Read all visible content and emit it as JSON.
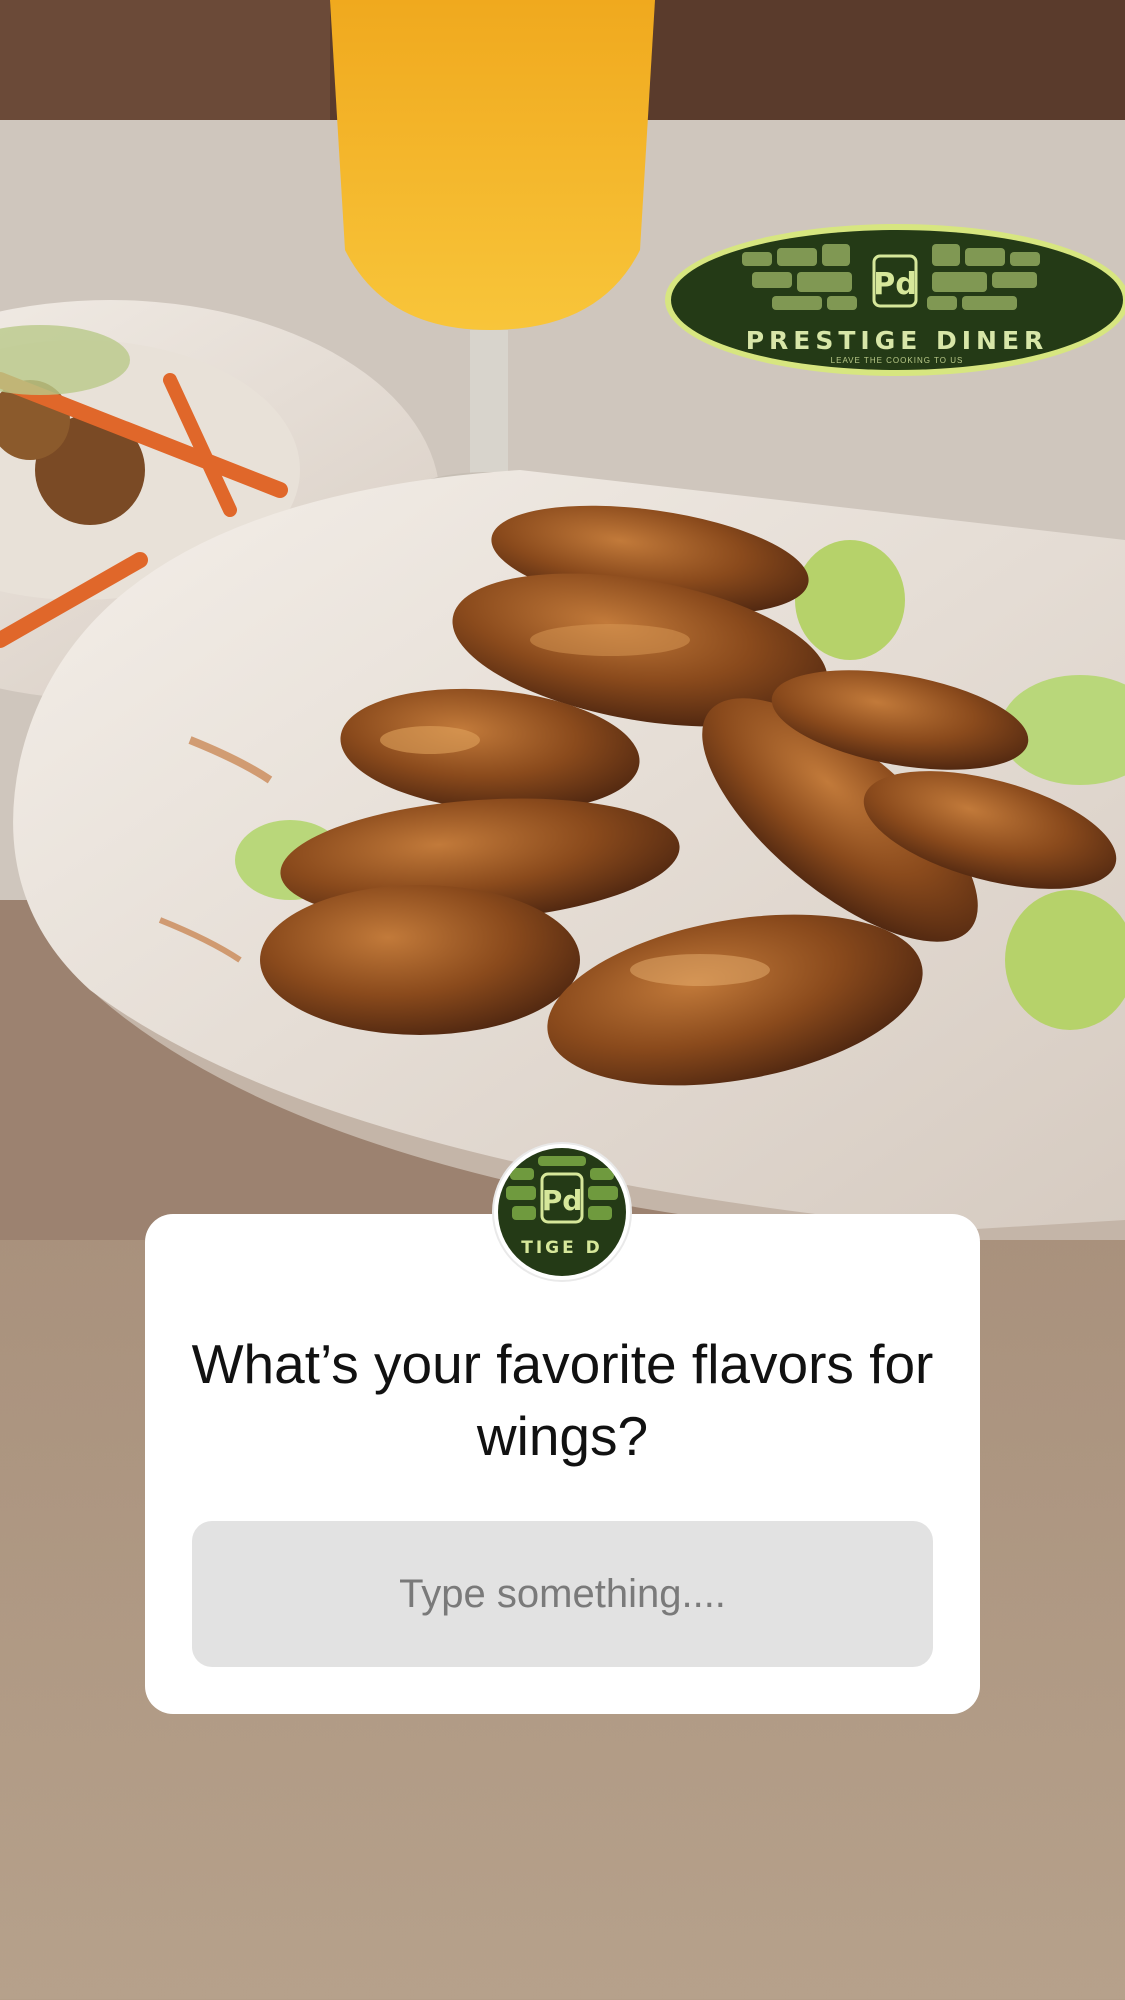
{
  "background_photo": {
    "description_icon": "chicken-wings-photo"
  },
  "brand": {
    "name": "PRESTIGE DINER",
    "tagline": "LEAVE THE COOKING TO US",
    "monogram": "Pd",
    "avatar_text": "TIGE D",
    "colors": {
      "logo_green": "#243a16",
      "logo_accent": "#d6e79a",
      "logo_ring": "#d7e680"
    }
  },
  "question_sticker": {
    "question": "What’s your favorite flavors for wings?",
    "answer_placeholder": "Type something...."
  }
}
